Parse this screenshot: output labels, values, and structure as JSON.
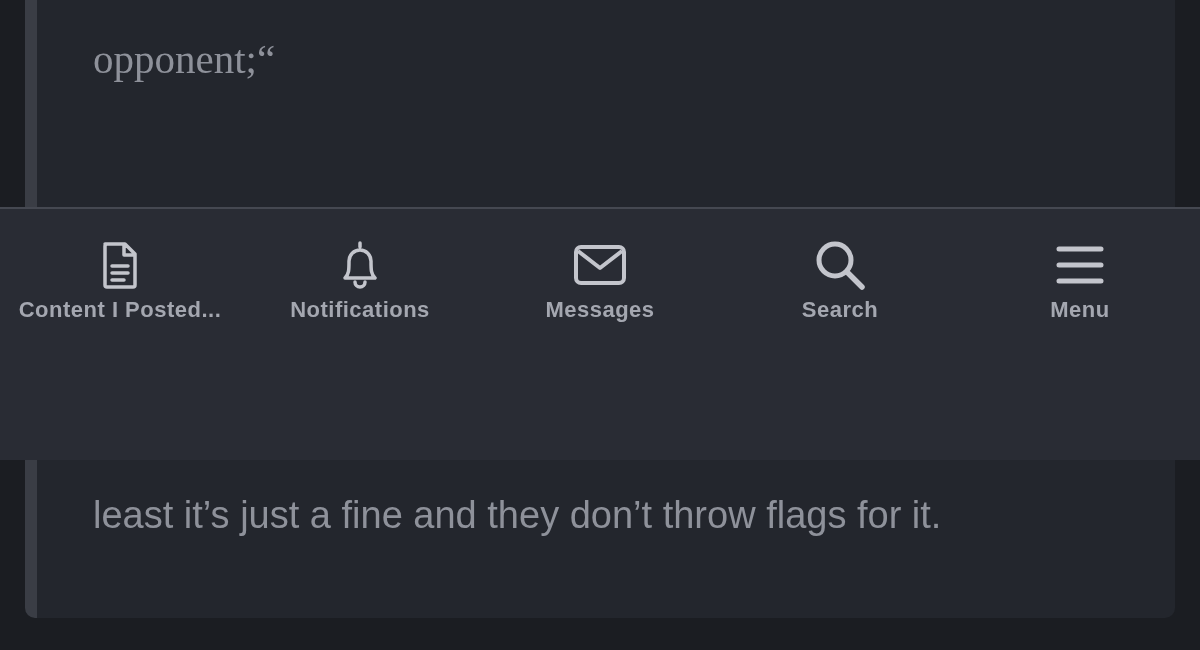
{
  "quote": {
    "lines": [
      {
        "kind": "serif",
        "text": "opponent;“"
      },
      {
        "kind": "sans",
        "text": "least it’s just a fine and they don’t throw flags for it."
      }
    ]
  },
  "tab_bar": {
    "items": [
      {
        "label": "Content I Posted..."
      },
      {
        "label": "Notifications"
      },
      {
        "label": "Messages"
      },
      {
        "label": "Search"
      },
      {
        "label": "Menu"
      }
    ]
  }
}
